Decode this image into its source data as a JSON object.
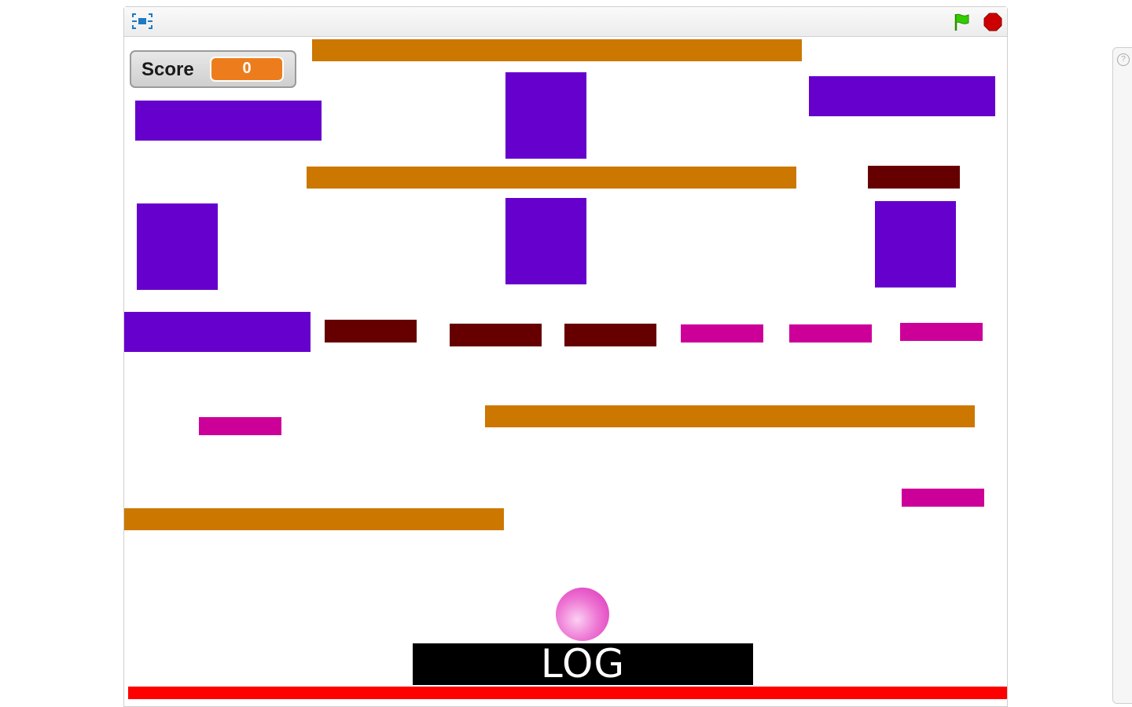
{
  "game": {
    "score_label": "Score",
    "score_value": "0",
    "log_label": "LOG",
    "colors": {
      "orange_platform": "#cc7700",
      "purple_block": "#6600cc",
      "dark_red_block": "#660000",
      "magenta_block": "#cc0099",
      "floor": "#ff0000",
      "log_bar": "#000000",
      "ball": "#e94fc6",
      "score_value_bg": "#ed7d1c",
      "green_flag": "#33cc00",
      "stop_sign": "#cc0000"
    }
  },
  "toolbar": {
    "fullscreen_icon": "fullscreen-icon",
    "green_flag_icon": "green-flag-icon",
    "stop_icon": "stop-icon"
  },
  "side_panel": {
    "help_label": "?"
  }
}
